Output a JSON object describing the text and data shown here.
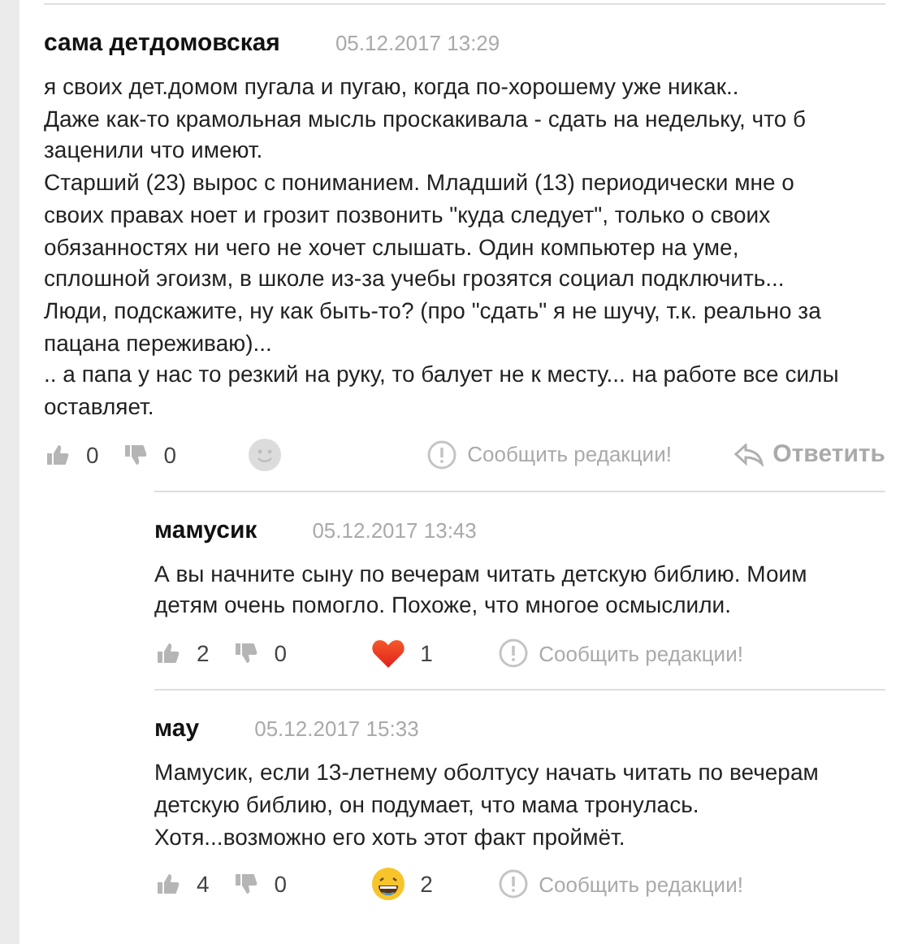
{
  "comments": [
    {
      "author": "сама детдомовская",
      "date": "05.12.2017 13:29",
      "reply": false,
      "text": "я своих дет.домом пугала и пугаю, когда по-хорошему уже никак..\nДаже как-то крамольная мысль проскакивала - сдать на недельку, что б заценили что имеют.\nСтарший (23) вырос с пониманием. Младший (13) периодически мне о своих правах ноет и грозит позвонить \"куда следует\", только о своих обязанностях ни чего не хочет слышать. Один компьютер на уме, сплошной эгоизм, в школе из-за учебы грозятся социал подключить...\nЛюди, подскажите, ну как быть-то? (про \"сдать\" я не шучу, т.к. реально за пацана переживаю)...\n.. а папа у нас то резкий на руку, то балует не к месту... на работе все силы оставляет.",
      "likes": "0",
      "dislikes": "0",
      "reaction": {
        "kind": "none"
      },
      "report": "Сообщить редакции!",
      "answer": "Ответить"
    },
    {
      "author": "мамусик",
      "date": "05.12.2017 13:43",
      "reply": true,
      "text": "А вы начните сыну по вечерам читать детскую библию. Моим детям очень помогло. Похоже, что многое осмыслили.",
      "likes": "2",
      "dislikes": "0",
      "reaction": {
        "kind": "heart",
        "count": "1"
      },
      "report": "Сообщить редакции!"
    },
    {
      "author": "мау",
      "date": "05.12.2017 15:33",
      "reply": true,
      "text": "Мамусик, если 13-летнему оболтусу начать читать по вечерам детскую библию, он подумает, что мама тронулась.\nХотя...возможно его хоть этот факт проймёт.",
      "likes": "4",
      "dislikes": "0",
      "reaction": {
        "kind": "laugh",
        "count": "2"
      },
      "report": "Сообщить редакции!"
    }
  ]
}
